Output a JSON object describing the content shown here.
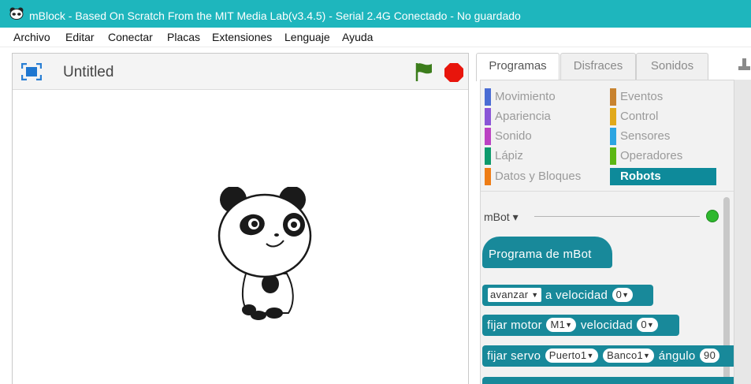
{
  "window": {
    "title": "mBlock - Based On Scratch From the MIT Media Lab(v3.4.5) - Serial 2.4G Conectado - No guardado"
  },
  "menu": [
    "Archivo",
    "Editar",
    "Conectar",
    "Placas",
    "Extensiones",
    "Lenguaje",
    "Ayuda"
  ],
  "stage": {
    "title": "Untitled"
  },
  "tabs": [
    "Programas",
    "Disfraces",
    "Sonidos"
  ],
  "categories": [
    {
      "label": "Movimiento",
      "color": "#4a6cd4"
    },
    {
      "label": "Eventos",
      "color": "#c88330"
    },
    {
      "label": "Apariencia",
      "color": "#8a55d7"
    },
    {
      "label": "Control",
      "color": "#e1a91a"
    },
    {
      "label": "Sonido",
      "color": "#bb42c3"
    },
    {
      "label": "Sensores",
      "color": "#2ca5e2"
    },
    {
      "label": "Lápiz",
      "color": "#0e9a6c"
    },
    {
      "label": "Operadores",
      "color": "#5cb712"
    },
    {
      "label": "Datos y Bloques",
      "color": "#ee7d16"
    },
    {
      "label": "Robots",
      "color": "#0e8a9a"
    }
  ],
  "selected_category": "Robots",
  "extension": {
    "label": "mBot",
    "arrow": "▾",
    "status_color": "#2eb82e"
  },
  "blocks": {
    "hat": "Programa de mBot",
    "move": {
      "dir": "avanzar",
      "text": "a velocidad",
      "speed": "0"
    },
    "motor": {
      "text1": "fijar motor",
      "port": "M1",
      "text2": "velocidad",
      "speed": "0"
    },
    "servo": {
      "text1": "fijar servo",
      "port": "Puerto1",
      "slot": "Banco1",
      "text2": "ángulo",
      "angle": "90"
    }
  },
  "colors": {
    "titlebar": "#1eb6bd",
    "block": "#18899a",
    "stop": "#e8150c",
    "flag": "#3c7d1c"
  }
}
